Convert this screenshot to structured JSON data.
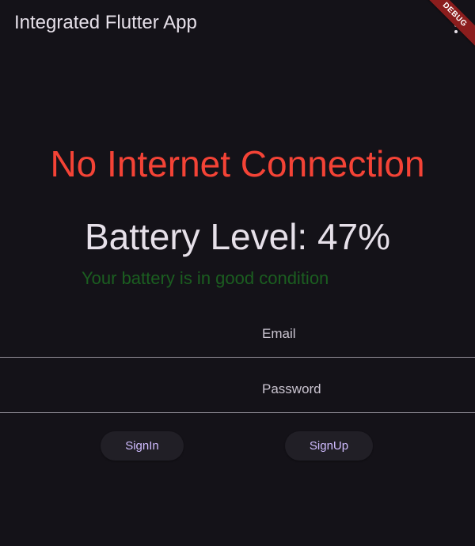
{
  "appbar": {
    "title": "Integrated Flutter App",
    "action_icon": "more-vert-icon",
    "debug_banner": "DEBUG"
  },
  "connectivity": {
    "message": "No Internet Connection",
    "color": "#f44336"
  },
  "battery": {
    "level_text": "Battery Level: 47%",
    "level_percent": 47,
    "status_text": "Your battery is in good condition",
    "status_color": "#1b5e20"
  },
  "form": {
    "email_label": "Email",
    "email_value": "",
    "password_label": "Password",
    "password_value": ""
  },
  "buttons": {
    "signin_label": "SignIn",
    "signup_label": "SignUp",
    "accent_color": "#d0bcff"
  }
}
